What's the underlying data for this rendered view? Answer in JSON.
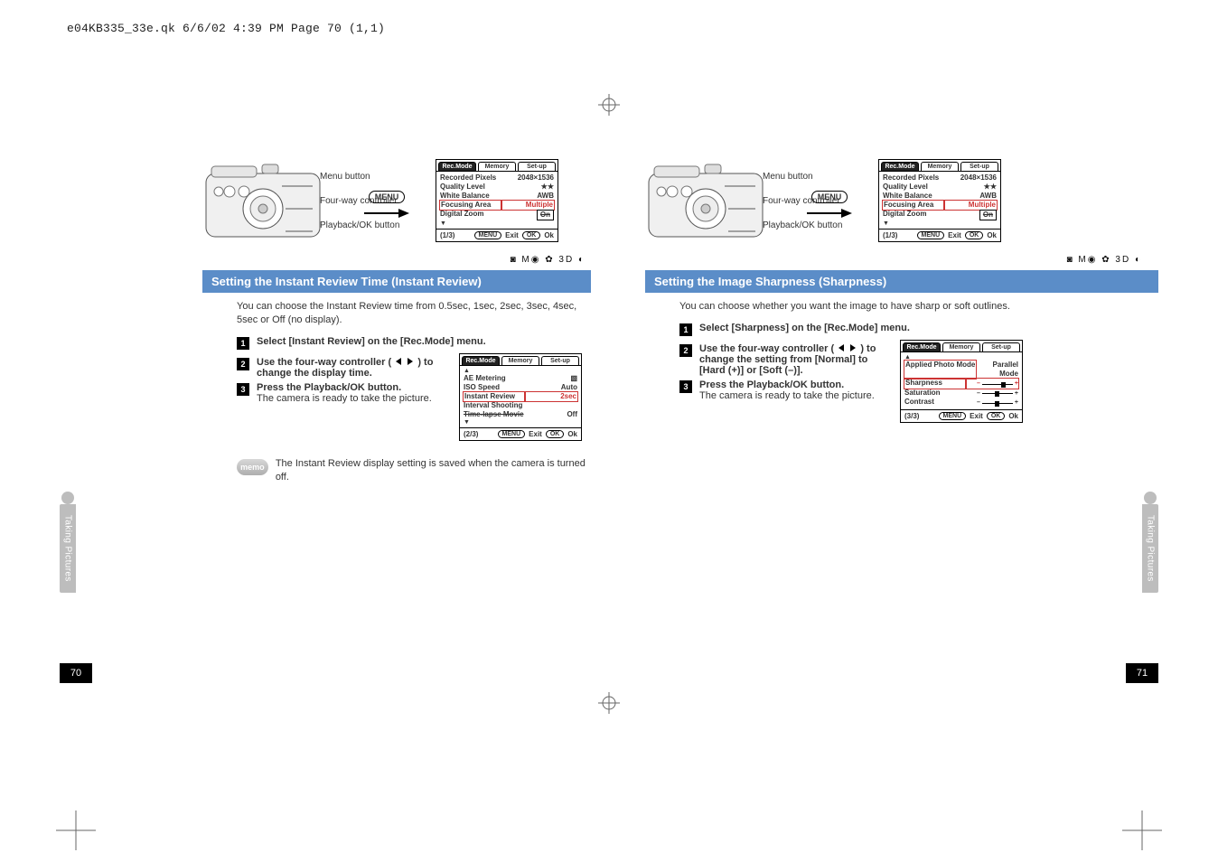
{
  "header": "e04KB335_33e.qk  6/6/02  4:39 PM  Page 70  (1,1)",
  "mode_strip": "◙ M◉ ✿ 3D ◐",
  "left": {
    "side_tab": "Taking Pictures",
    "page_num": "70",
    "camera": {
      "menu_label": "Menu button",
      "fourway_label": "Four-way controller",
      "playback_label": "Playback/OK button",
      "menu_arrow_label": "MENU"
    },
    "screen1": {
      "tabs": [
        "Rec.Mode",
        "Memory",
        "Set-up"
      ],
      "active_tab": 0,
      "rows": [
        {
          "k": "Recorded Pixels",
          "v": "2048×1536"
        },
        {
          "k": "Quality Level",
          "v": "★★"
        },
        {
          "k": "White Balance",
          "v": "AWB"
        },
        {
          "k": "Focusing Area",
          "v": "Multiple",
          "selected": true
        },
        {
          "k": "Digital Zoom",
          "v": "On",
          "vstrike": true
        }
      ],
      "arrow_down": "▼",
      "footer": {
        "page": "(1/3)",
        "menu": "MENU",
        "exit": "Exit",
        "ok": "OK",
        "oklabel": "Ok"
      }
    },
    "bluebar": "Setting the Instant Review Time (Instant Review)",
    "intro": "You can choose the Instant Review time from 0.5sec, 1sec, 2sec, 3sec, 4sec, 5sec or Off (no display).",
    "steps": [
      {
        "n": "1",
        "hd": "Select [Instant Review] on the [Rec.Mode] menu."
      },
      {
        "n": "2",
        "hd_prefix": "Use the four-way controller (",
        "hd_suffix": ") to change the display time."
      },
      {
        "n": "3",
        "hd": "Press the Playback/OK button.",
        "bd": "The camera is ready to take the picture."
      }
    ],
    "screen2": {
      "tabs": [
        "Rec.Mode",
        "Memory",
        "Set-up"
      ],
      "active_tab": 0,
      "rows_top_arrow": "▲",
      "rows": [
        {
          "k": "AE Metering",
          "v": "▧"
        },
        {
          "k": "ISO Speed",
          "v": "Auto"
        },
        {
          "k": "Instant Review",
          "v": "2sec",
          "selected": true
        },
        {
          "k": "Interval Shooting",
          "v": ""
        },
        {
          "k": "Time-lapse Movie",
          "v": "Off",
          "kstrike": true
        }
      ],
      "arrow_down": "▼",
      "footer": {
        "page": "(2/3)",
        "menu": "MENU",
        "exit": "Exit",
        "ok": "OK",
        "oklabel": "Ok"
      }
    },
    "memo": {
      "label": "memo",
      "text": "The Instant Review display setting is saved when the camera is turned off."
    }
  },
  "right": {
    "side_tab": "Taking Pictures",
    "page_num": "71",
    "camera": {
      "menu_label": "Menu button",
      "fourway_label": "Four-way controller",
      "playback_label": "Playback/OK button",
      "menu_arrow_label": "MENU"
    },
    "screen1": {
      "tabs": [
        "Rec.Mode",
        "Memory",
        "Set-up"
      ],
      "active_tab": 0,
      "rows": [
        {
          "k": "Recorded Pixels",
          "v": "2048×1536"
        },
        {
          "k": "Quality Level",
          "v": "★★"
        },
        {
          "k": "White Balance",
          "v": "AWB"
        },
        {
          "k": "Focusing Area",
          "v": "Multiple",
          "selected": true
        },
        {
          "k": "Digital Zoom",
          "v": "On",
          "vstrike": true
        }
      ],
      "arrow_down": "▼",
      "footer": {
        "page": "(1/3)",
        "menu": "MENU",
        "exit": "Exit",
        "ok": "OK",
        "oklabel": "Ok"
      }
    },
    "bluebar": "Setting the Image Sharpness (Sharpness)",
    "intro": "You can choose whether you want the image to have sharp or soft outlines.",
    "steps": [
      {
        "n": "1",
        "hd": "Select [Sharpness] on the [Rec.Mode] menu."
      },
      {
        "n": "2",
        "hd_prefix": "Use the four-way controller (",
        "hd_suffix": ") to change the setting from [Normal] to [Hard (+)] or [Soft (–)]."
      },
      {
        "n": "3",
        "hd": "Press the Playback/OK button.",
        "bd": "The camera is ready to take the picture."
      }
    ],
    "screen2": {
      "tabs": [
        "Rec.Mode",
        "Memory",
        "Set-up"
      ],
      "active_tab": 0,
      "rows_top_arrow": "▲",
      "rows": [
        {
          "k": "Applied Photo Mode",
          "v": "Parallel Mode",
          "kselected": true
        },
        {
          "k": "Sharpness",
          "slider": 0.75,
          "selected": true
        },
        {
          "k": "Saturation",
          "slider": 0.5
        },
        {
          "k": "Contrast",
          "slider": 0.5
        }
      ],
      "footer": {
        "page": "(3/3)",
        "menu": "MENU",
        "exit": "Exit",
        "ok": "OK",
        "oklabel": "Ok"
      }
    }
  }
}
